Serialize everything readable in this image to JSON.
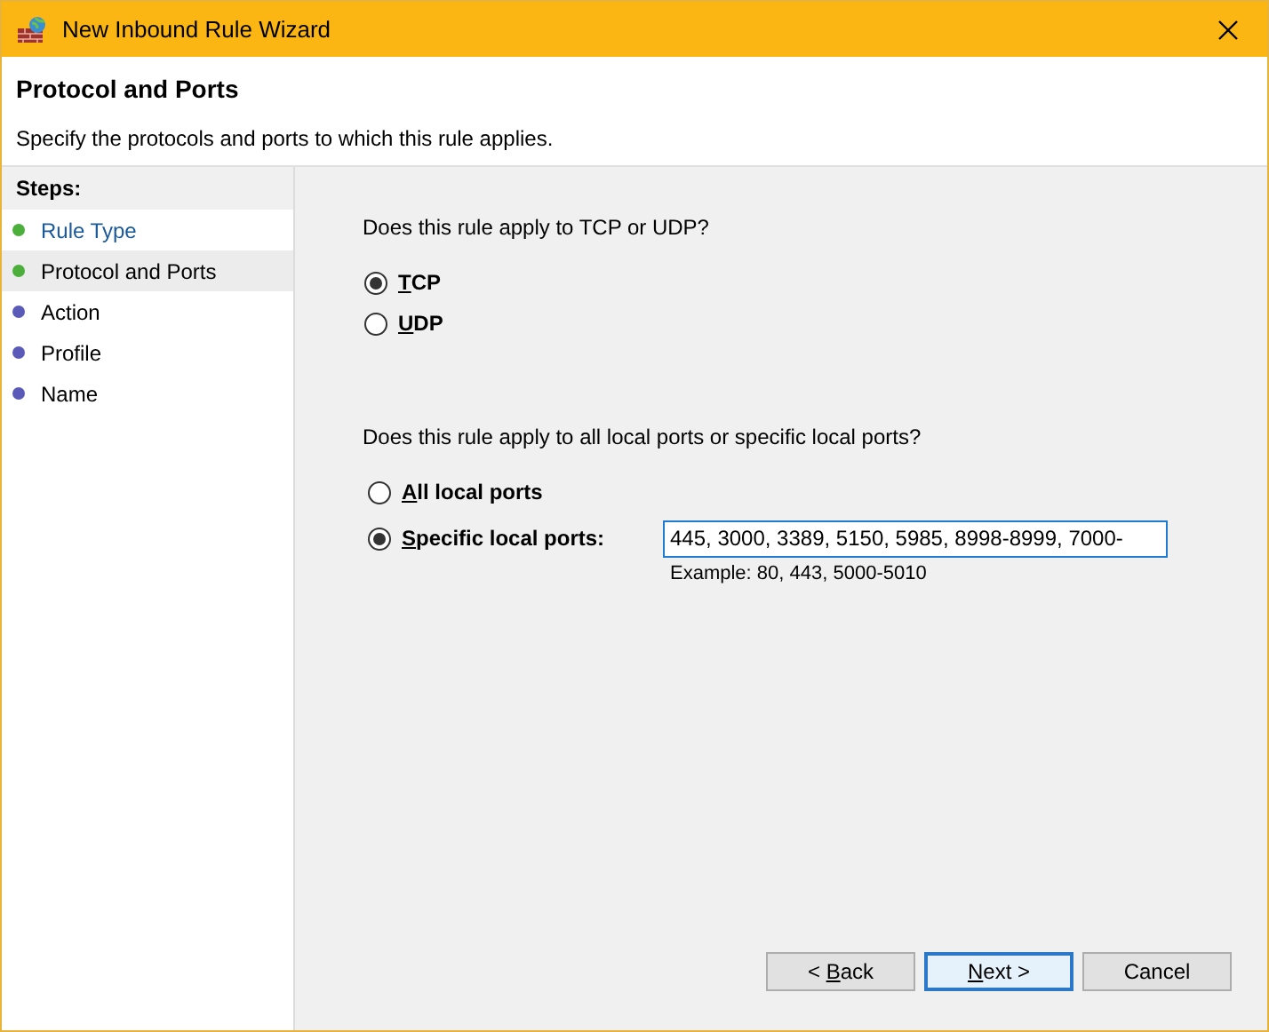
{
  "window": {
    "title": "New Inbound Rule Wizard"
  },
  "header": {
    "title": "Protocol and Ports",
    "subtitle": "Specify the protocols and ports to which this rule applies."
  },
  "steps": {
    "title": "Steps:",
    "items": [
      {
        "label": "Rule Type",
        "color": "#4caf3c",
        "selected": false,
        "link": true
      },
      {
        "label": "Protocol and Ports",
        "color": "#4caf3c",
        "selected": true,
        "link": false
      },
      {
        "label": "Action",
        "color": "#5a5ab8",
        "selected": false,
        "link": false
      },
      {
        "label": "Profile",
        "color": "#5a5ab8",
        "selected": false,
        "link": false
      },
      {
        "label": "Name",
        "color": "#5a5ab8",
        "selected": false,
        "link": false
      }
    ]
  },
  "protocol": {
    "question": "Does this rule apply to TCP or UDP?",
    "options": [
      {
        "accel": "T",
        "rest": "CP",
        "selected": true
      },
      {
        "accel": "U",
        "rest": "DP",
        "selected": false
      }
    ]
  },
  "ports": {
    "question": "Does this rule apply to all local ports or specific local ports?",
    "options": [
      {
        "accel": "A",
        "rest": "ll local ports",
        "selected": false
      },
      {
        "accel": "S",
        "rest": "pecific local ports:",
        "selected": true
      }
    ],
    "value": "445, 3000, 3389, 5150, 5985, 8998-8999, 7000-",
    "example": "Example: 80, 443, 5000-5010"
  },
  "buttons": [
    {
      "pre": "< ",
      "accel": "B",
      "rest": "ack",
      "default": false
    },
    {
      "accel": "N",
      "rest": "ext >",
      "default": true
    },
    {
      "rest": "Cancel",
      "default": false
    }
  ]
}
